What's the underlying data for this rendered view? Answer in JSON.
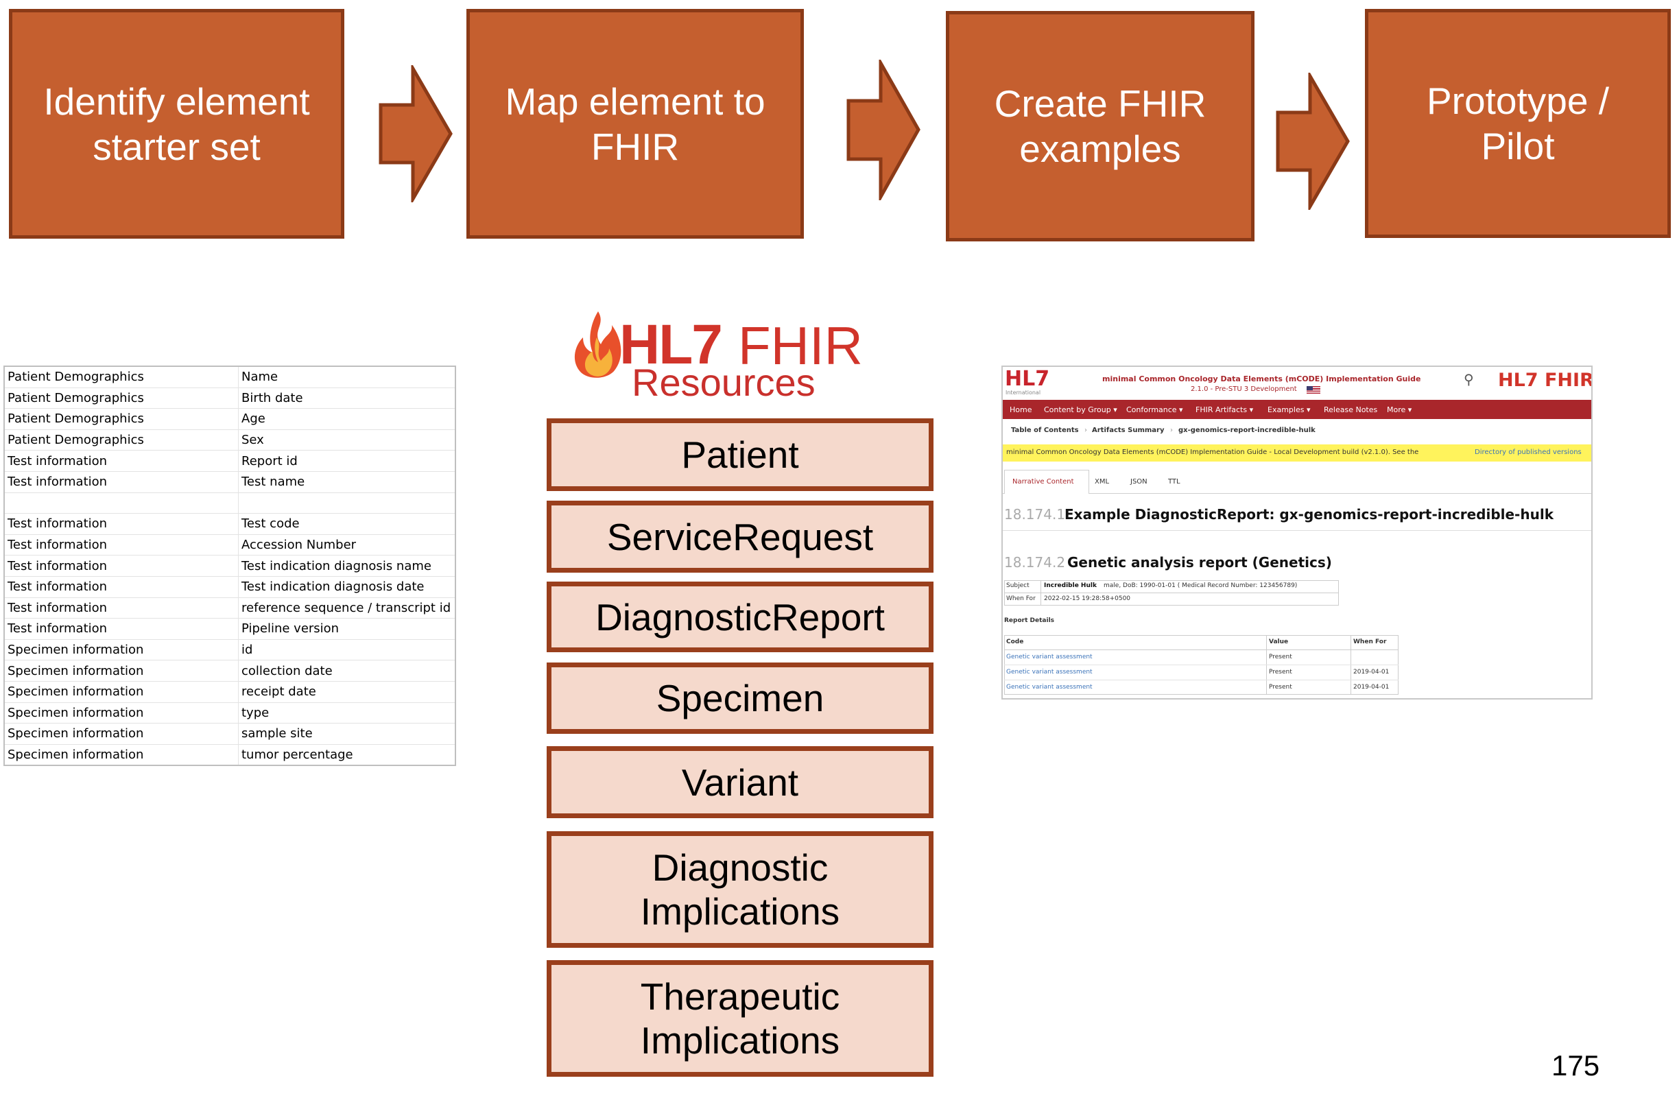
{
  "process": {
    "steps": [
      {
        "label": "Identify element starter set"
      },
      {
        "label": "Map element to FHIR"
      },
      {
        "label": "Create FHIR examples"
      },
      {
        "label": "Prototype / Pilot"
      }
    ],
    "colors": {
      "box": "#c55f2f",
      "border": "#8b3a17",
      "text": "#ffffff"
    }
  },
  "element_table": {
    "rows": [
      [
        "Patient Demographics",
        "Name"
      ],
      [
        "Patient Demographics",
        "Birth date"
      ],
      [
        "Patient Demographics",
        "Age"
      ],
      [
        "Patient Demographics",
        "Sex"
      ],
      [
        "Test information",
        "Report id"
      ],
      [
        "Test information",
        "Test name"
      ],
      [
        "",
        ""
      ],
      [
        "Test information",
        "Test code"
      ],
      [
        "Test information",
        "Accession Number"
      ],
      [
        "Test information",
        "Test indication diagnosis name"
      ],
      [
        "Test information",
        "Test indication diagnosis date"
      ],
      [
        "Test information",
        "reference sequence / transcript id"
      ],
      [
        "Test information",
        "Pipeline version"
      ],
      [
        "Specimen information",
        "id"
      ],
      [
        "Specimen information",
        "collection date"
      ],
      [
        "Specimen information",
        "receipt date"
      ],
      [
        "Specimen information",
        "type"
      ],
      [
        "Specimen information",
        "sample site"
      ],
      [
        "Specimen information",
        "tumor percentage"
      ]
    ]
  },
  "fhir_logo": {
    "hl7": "HL7",
    "fhir": "FHIR",
    "resources": "Resources"
  },
  "resources": {
    "items": [
      {
        "label": "Patient"
      },
      {
        "label": "ServiceRequest"
      },
      {
        "label": "DiagnosticReport"
      },
      {
        "label": "Specimen"
      },
      {
        "label": "Variant"
      },
      {
        "label": "Diagnostic Implications"
      },
      {
        "label": "Therapeutic Implications"
      }
    ],
    "colors": {
      "fill": "#f5d9cc",
      "border": "#9a3f1c"
    }
  },
  "ig_page": {
    "brand": "HL7",
    "brand_sub": "International",
    "title": "minimal Common Oncology Data Elements (mCODE) Implementation Guide",
    "version": "2.1.0 - Pre-STU 3 Development",
    "logo_right": "HL7 FHIR",
    "nav": [
      "Home",
      "Content by Group ▾",
      "Conformance ▾",
      "FHIR Artifacts ▾",
      "Examples ▾",
      "Release Notes",
      "More ▾"
    ],
    "breadcrumb": [
      "Table of Contents",
      "Artifacts Summary",
      "gx-genomics-report-incredible-hulk"
    ],
    "notice": "minimal Common Oncology Data Elements (mCODE) Implementation Guide - Local Development build (v2.1.0). See the",
    "notice_link": "Directory of published versions",
    "tabs": [
      "Narrative Content",
      "XML",
      "JSON",
      "TTL"
    ],
    "heading1_num": "18.174.1",
    "heading1": "Example DiagnosticReport: gx-genomics-report-incredible-hulk",
    "heading2_num": "18.174.2",
    "heading2": "Genetic analysis report (Genetics)",
    "subject_label": "Subject",
    "subject_name": "Incredible Hulk",
    "subject_rest": "male, DoB: 1990-01-01 ( Medical Record Number: 123456789)",
    "whenfor_label": "When For",
    "whenfor_value": "2022-02-15 19:28:58+0500",
    "report_details": "Report Details",
    "table_headers": [
      "Code",
      "Value",
      "When For"
    ],
    "table_rows": [
      [
        "Genetic variant assessment",
        "Present",
        ""
      ],
      [
        "Genetic variant assessment",
        "Present",
        "2019-04-01"
      ],
      [
        "Genetic variant assessment",
        "Present",
        "2019-04-01"
      ]
    ],
    "colors": {
      "nav": "#a9262b",
      "notice": "#fff35c",
      "link": "#3b73b9"
    }
  },
  "page_number": "175"
}
